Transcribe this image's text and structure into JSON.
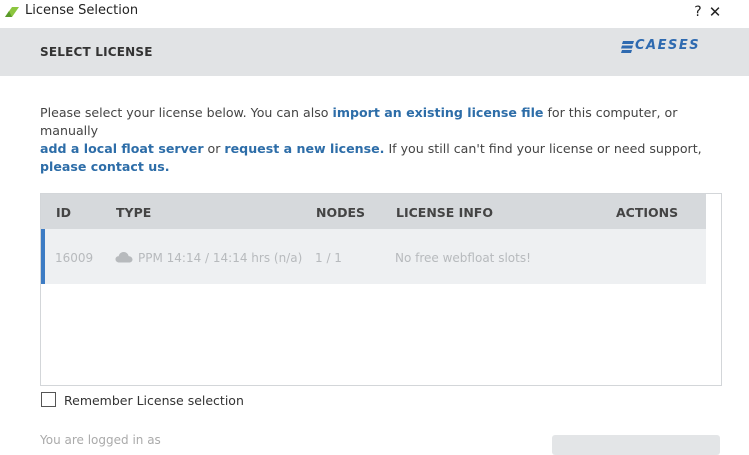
{
  "window": {
    "title": "License Selection",
    "help_label": "?",
    "close_label": "✕"
  },
  "header": {
    "title": "SELECT LICENSE",
    "logo_text": "CAESES",
    "accent_color": "#2e6ab0"
  },
  "intro": {
    "t1": "Please select your license below. You can also ",
    "link_import": "import an existing license file",
    "t2": " for this computer, or manually ",
    "link_float": "add a local float server",
    "t3": " or ",
    "link_request": "request a new license.",
    "t4": " If you still can't find your license or need support, ",
    "link_contact": "please contact us."
  },
  "table": {
    "columns": [
      "ID",
      "TYPE",
      "NODES",
      "LICENSE INFO",
      "ACTIONS"
    ],
    "rows": [
      {
        "id": "16009",
        "type": "PPM 14:14 / 14:14 hrs (n/a)",
        "type_icon": "cloud-icon",
        "nodes": "1 / 1",
        "info": "No free webfloat slots!",
        "actions": ""
      }
    ]
  },
  "remember": {
    "label": "Remember License selection",
    "checked": false
  },
  "footer": {
    "logged_in_text": "You are logged in as"
  }
}
